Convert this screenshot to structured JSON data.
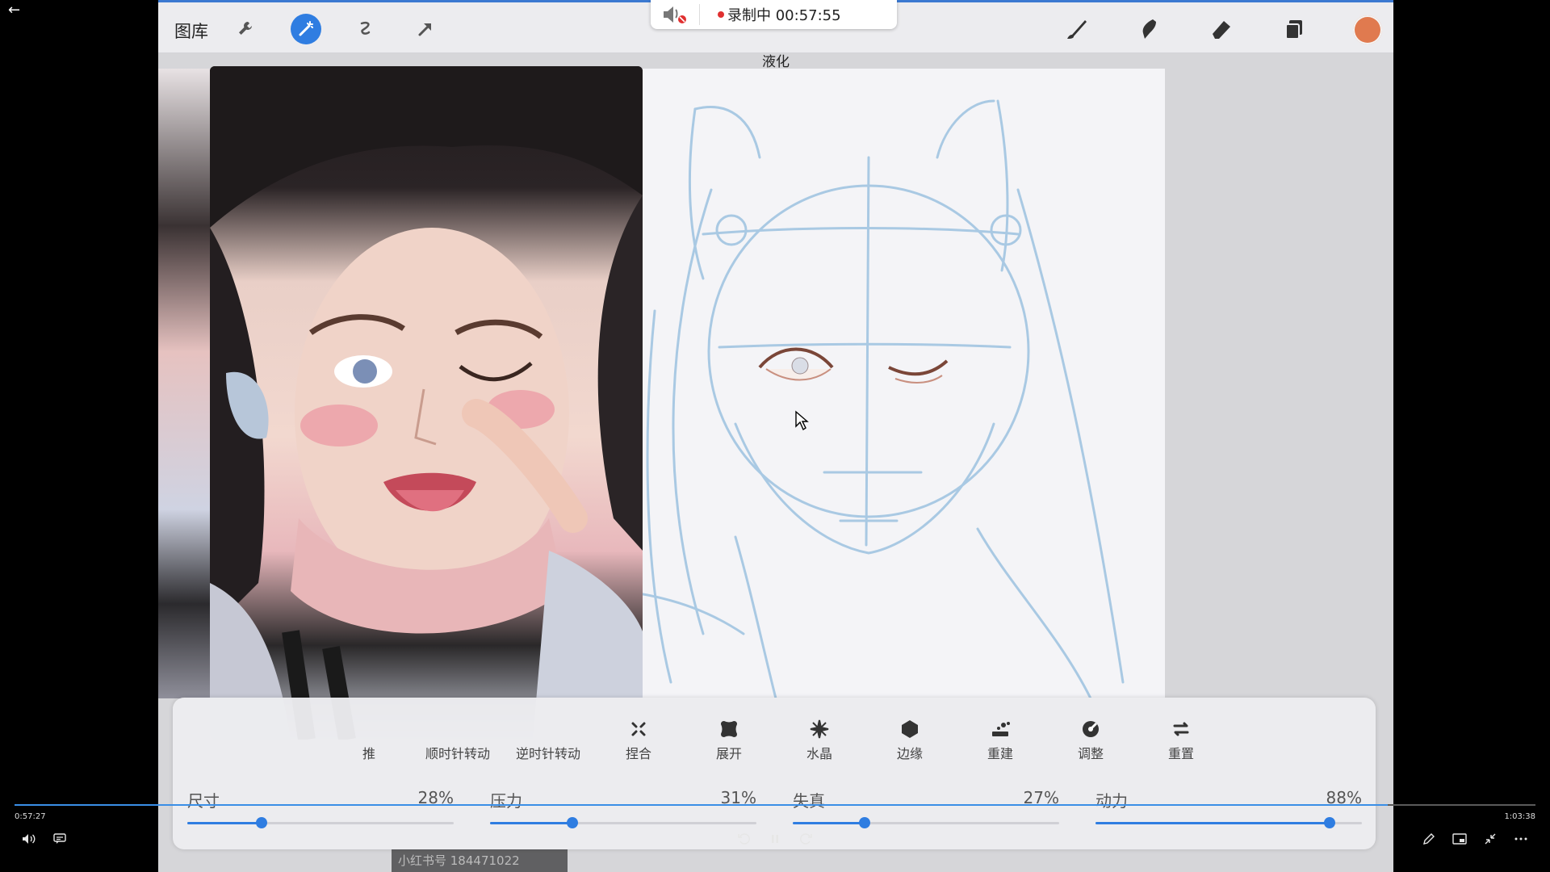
{
  "toolbar": {
    "gallery_label": "图库",
    "tools_left": [
      "wrench-icon",
      "magic-wand-icon",
      "selection-icon",
      "transform-arrow-icon"
    ],
    "tools_right": [
      "brush-icon",
      "smudge-icon",
      "eraser-icon",
      "layers-icon"
    ],
    "color_swatch": "#e07a4f"
  },
  "recording": {
    "text": "录制中 00:57:55",
    "muted": true
  },
  "mode_title": "液化",
  "liquify_modes": [
    {
      "icon": "push-icon",
      "label": "推"
    },
    {
      "icon": "twirl-right-icon",
      "label": "顺时针转动"
    },
    {
      "icon": "twirl-left-icon",
      "label": "逆时针转动"
    },
    {
      "icon": "pinch-icon",
      "label": "捏合"
    },
    {
      "icon": "expand-icon",
      "label": "展开"
    },
    {
      "icon": "crystals-icon",
      "label": "水晶"
    },
    {
      "icon": "edge-icon",
      "label": "边缘"
    },
    {
      "icon": "reconstruct-icon",
      "label": "重建"
    },
    {
      "icon": "adjust-icon",
      "label": "调整"
    },
    {
      "icon": "reset-icon",
      "label": "重置"
    }
  ],
  "sliders": [
    {
      "name": "尺寸",
      "value": "28%",
      "level": 0.28
    },
    {
      "name": "压力",
      "value": "31%",
      "level": 0.31
    },
    {
      "name": "失真",
      "value": "27%",
      "level": 0.27
    },
    {
      "name": "动力",
      "value": "88%",
      "level": 0.88
    }
  ],
  "player": {
    "current_time": "0:57:27",
    "total_time": "1:03:38",
    "progress": 0.903,
    "rewind_seconds": "10",
    "forward_seconds": "30",
    "watermark": "小红书号 184471022"
  }
}
